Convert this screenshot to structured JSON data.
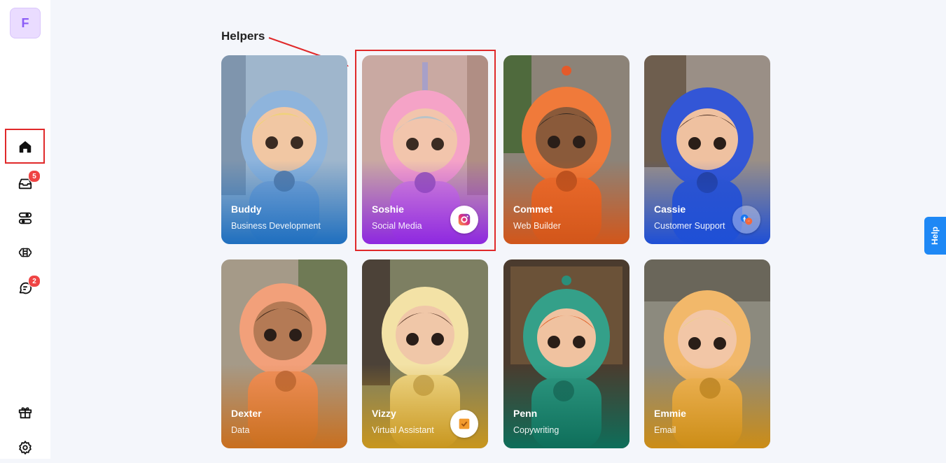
{
  "sidebar": {
    "avatar_letter": "F",
    "items": [
      {
        "icon": "home-icon"
      },
      {
        "icon": "inbox-icon",
        "badge": "5"
      },
      {
        "icon": "integrations-icon"
      },
      {
        "icon": "brain-icon"
      },
      {
        "icon": "chat-icon",
        "badge": "2"
      }
    ],
    "bottom_items": [
      {
        "icon": "gift-icon"
      },
      {
        "icon": "gear-icon"
      }
    ]
  },
  "main": {
    "section_title": "Helpers",
    "helpers": [
      {
        "name": "Buddy",
        "role": "Business Development"
      },
      {
        "name": "Soshie",
        "role": "Social Media",
        "badge_icon": "instagram-icon"
      },
      {
        "name": "Commet",
        "role": "Web Builder"
      },
      {
        "name": "Cassie",
        "role": "Customer Support",
        "badge_icon": "facebook-messenger-icon"
      },
      {
        "name": "Dexter",
        "role": "Data"
      },
      {
        "name": "Vizzy",
        "role": "Virtual Assistant",
        "badge_icon": "task-icon"
      },
      {
        "name": "Penn",
        "role": "Copywriting"
      },
      {
        "name": "Emmie",
        "role": "Email"
      }
    ]
  },
  "help_tab": {
    "label": "Help"
  },
  "colors": {
    "accent_red": "#e0292a",
    "help_blue": "#1e88f5",
    "avatar_bg": "#eadcff"
  }
}
